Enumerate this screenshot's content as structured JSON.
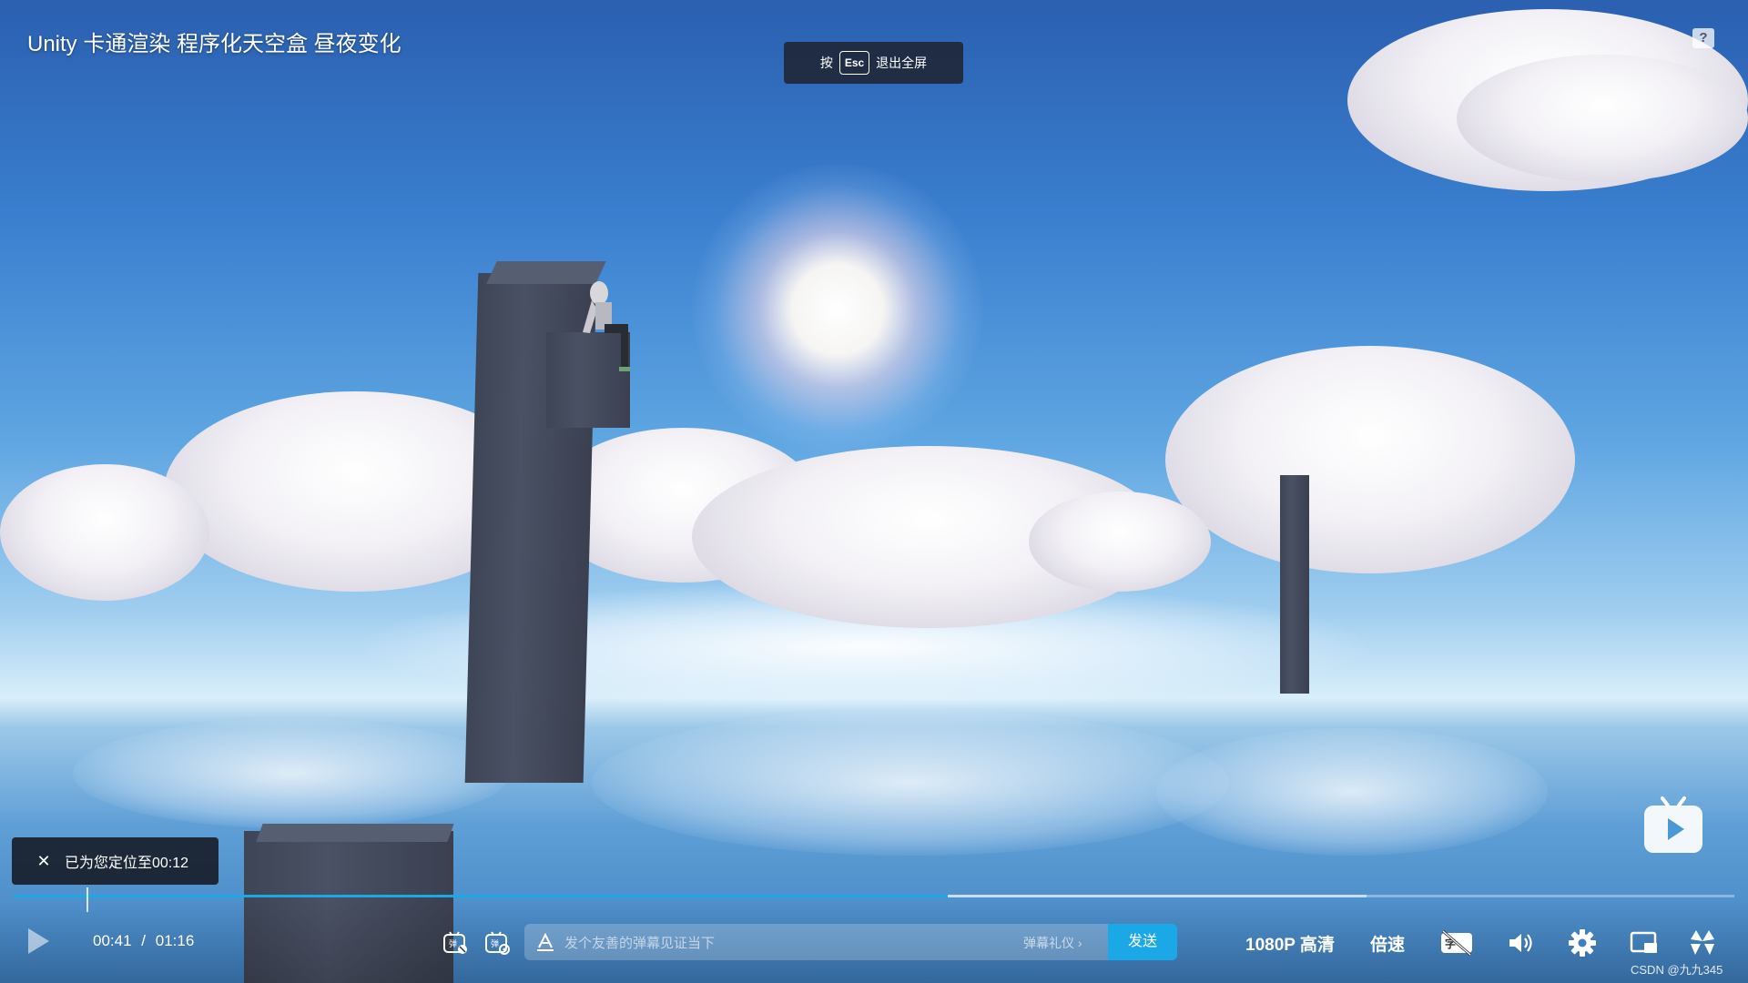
{
  "video": {
    "title": "Unity 卡通渲染 程序化天空盒 昼夜变化",
    "progress_played_fraction": 0.543,
    "progress_buffered_fraction": 0.786
  },
  "fullscreen_hint": {
    "press_label": "按",
    "key_label": "Esc",
    "exit_label": "退出全屏"
  },
  "help": {
    "label": "?"
  },
  "toast": {
    "close_glyph": "✕",
    "message": "已为您定位至00:12"
  },
  "controls": {
    "current_time": "00:41",
    "separator": "/",
    "duration": "01:16",
    "danmaku": {
      "placeholder": "发个友善的弹幕见证当下",
      "etiquette_label": "弹幕礼仪 ›",
      "send_label": "发送"
    },
    "quality_label": "1080P 高清",
    "speed_label": "倍速"
  },
  "watermark": "CSDN @九九345",
  "colors": {
    "accent": "#1aa8e6",
    "overlay_dark": "#1e2434"
  },
  "icons": [
    "play-icon",
    "danmaku-toggle-icon",
    "danmaku-settings-icon",
    "font-style-icon",
    "subtitle-off-icon",
    "volume-icon",
    "settings-gear-icon",
    "pip-icon",
    "fullscreen-icon",
    "help-icon",
    "bilibili-tv-icon",
    "close-icon"
  ]
}
